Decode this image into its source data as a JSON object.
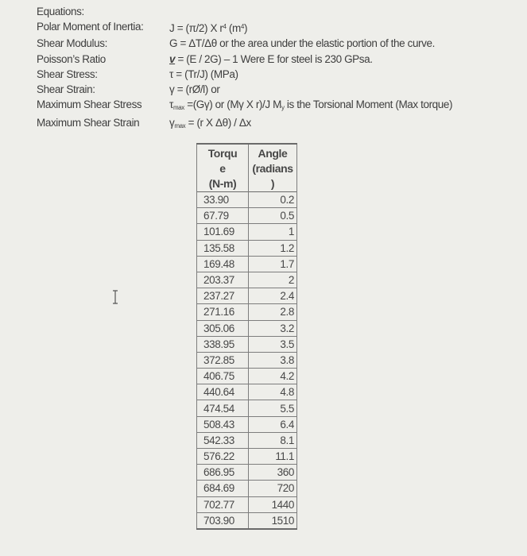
{
  "equations": {
    "heading": "Equations:",
    "rows": [
      {
        "label": "Polar Moment of Inertia:",
        "formula_pre": "J = (π/2) X r",
        "sup1": "4",
        "formula_mid": " (m",
        "sup2": "4",
        "formula_post": ")"
      },
      {
        "label": "Shear Modulus:",
        "formula": "G = ΔT/Δθ or the area under the elastic portion of the curve."
      },
      {
        "label": "Poisson’s Ratio",
        "symbol": "v",
        "formula": " = (E / 2G) – 1  Were E for steel is 230 GPsa."
      },
      {
        "label": "Shear Stress:",
        "formula": "τ = (Tr/J) (MPa)"
      },
      {
        "label": "Shear Strain:",
        "formula": "γ = (rØ/l)  or"
      },
      {
        "label": "Maximum Shear Stress",
        "symbol": "τ",
        "sub": "max",
        "formula": " =(Gγ) or (Mγ X r)/J   M",
        "sub2": "y",
        "formula_post": " is the Torsional Moment (Max torque)"
      },
      {
        "label": "Maximum Shear Strain",
        "symbol": "γ",
        "sub": "max",
        "formula": " = (r X Δθ) / Δx"
      }
    ]
  },
  "table": {
    "headers": [
      "Torque (N-m)",
      "Angle (radians)"
    ],
    "header_lines": [
      [
        "Torqu",
        "e",
        "(N-m)"
      ],
      [
        "Angle",
        "(radians",
        ")"
      ]
    ],
    "rows": [
      [
        "33.90",
        "0.2"
      ],
      [
        "67.79",
        "0.5"
      ],
      [
        "101.69",
        "1"
      ],
      [
        "135.58",
        "1.2"
      ],
      [
        "169.48",
        "1.7"
      ],
      [
        "203.37",
        "2"
      ],
      [
        "237.27",
        "2.4"
      ],
      [
        "271.16",
        "2.8"
      ],
      [
        "305.06",
        "3.2"
      ],
      [
        "338.95",
        "3.5"
      ],
      [
        "372.85",
        "3.8"
      ],
      [
        "406.75",
        "4.2"
      ],
      [
        "440.64",
        "4.8"
      ],
      [
        "474.54",
        "5.5"
      ],
      [
        "508.43",
        "6.4"
      ],
      [
        "542.33",
        "8.1"
      ],
      [
        "576.22",
        "11.1"
      ],
      [
        "686.95",
        "360"
      ],
      [
        "684.69",
        "720"
      ],
      [
        "702.77",
        "1440"
      ],
      [
        "703.90",
        "1510"
      ]
    ]
  },
  "cursor": {
    "icon": "text-cursor-icon"
  }
}
